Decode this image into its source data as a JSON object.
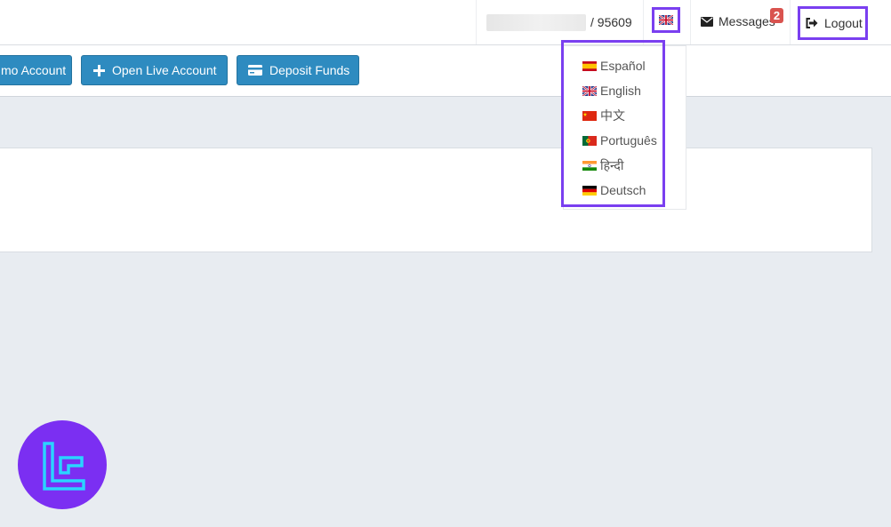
{
  "header": {
    "account_id": "/ 95609",
    "messages_label": "Messages",
    "messages_count": "2",
    "logout_label": "Logout",
    "current_language_flag": "uk-flag-icon"
  },
  "actions": {
    "demo_account_label": "mo Account",
    "open_live_account_label": "Open Live Account",
    "deposit_funds_label": "Deposit Funds"
  },
  "language_menu": {
    "items": [
      {
        "label": "Español",
        "flag": "spain-flag-icon"
      },
      {
        "label": "English",
        "flag": "uk-flag-icon"
      },
      {
        "label": "中文",
        "flag": "china-flag-icon"
      },
      {
        "label": "Português",
        "flag": "portugal-flag-icon"
      },
      {
        "label": "हिन्दी",
        "flag": "india-flag-icon"
      },
      {
        "label": "Deutsch",
        "flag": "germany-flag-icon"
      }
    ]
  },
  "colors": {
    "primary_button": "#2e8bc0",
    "highlight_outline": "#7a3ff0",
    "badge": "#d9534f",
    "logo_bg": "#7b2ff2",
    "logo_fg": "#2ad4ff"
  }
}
